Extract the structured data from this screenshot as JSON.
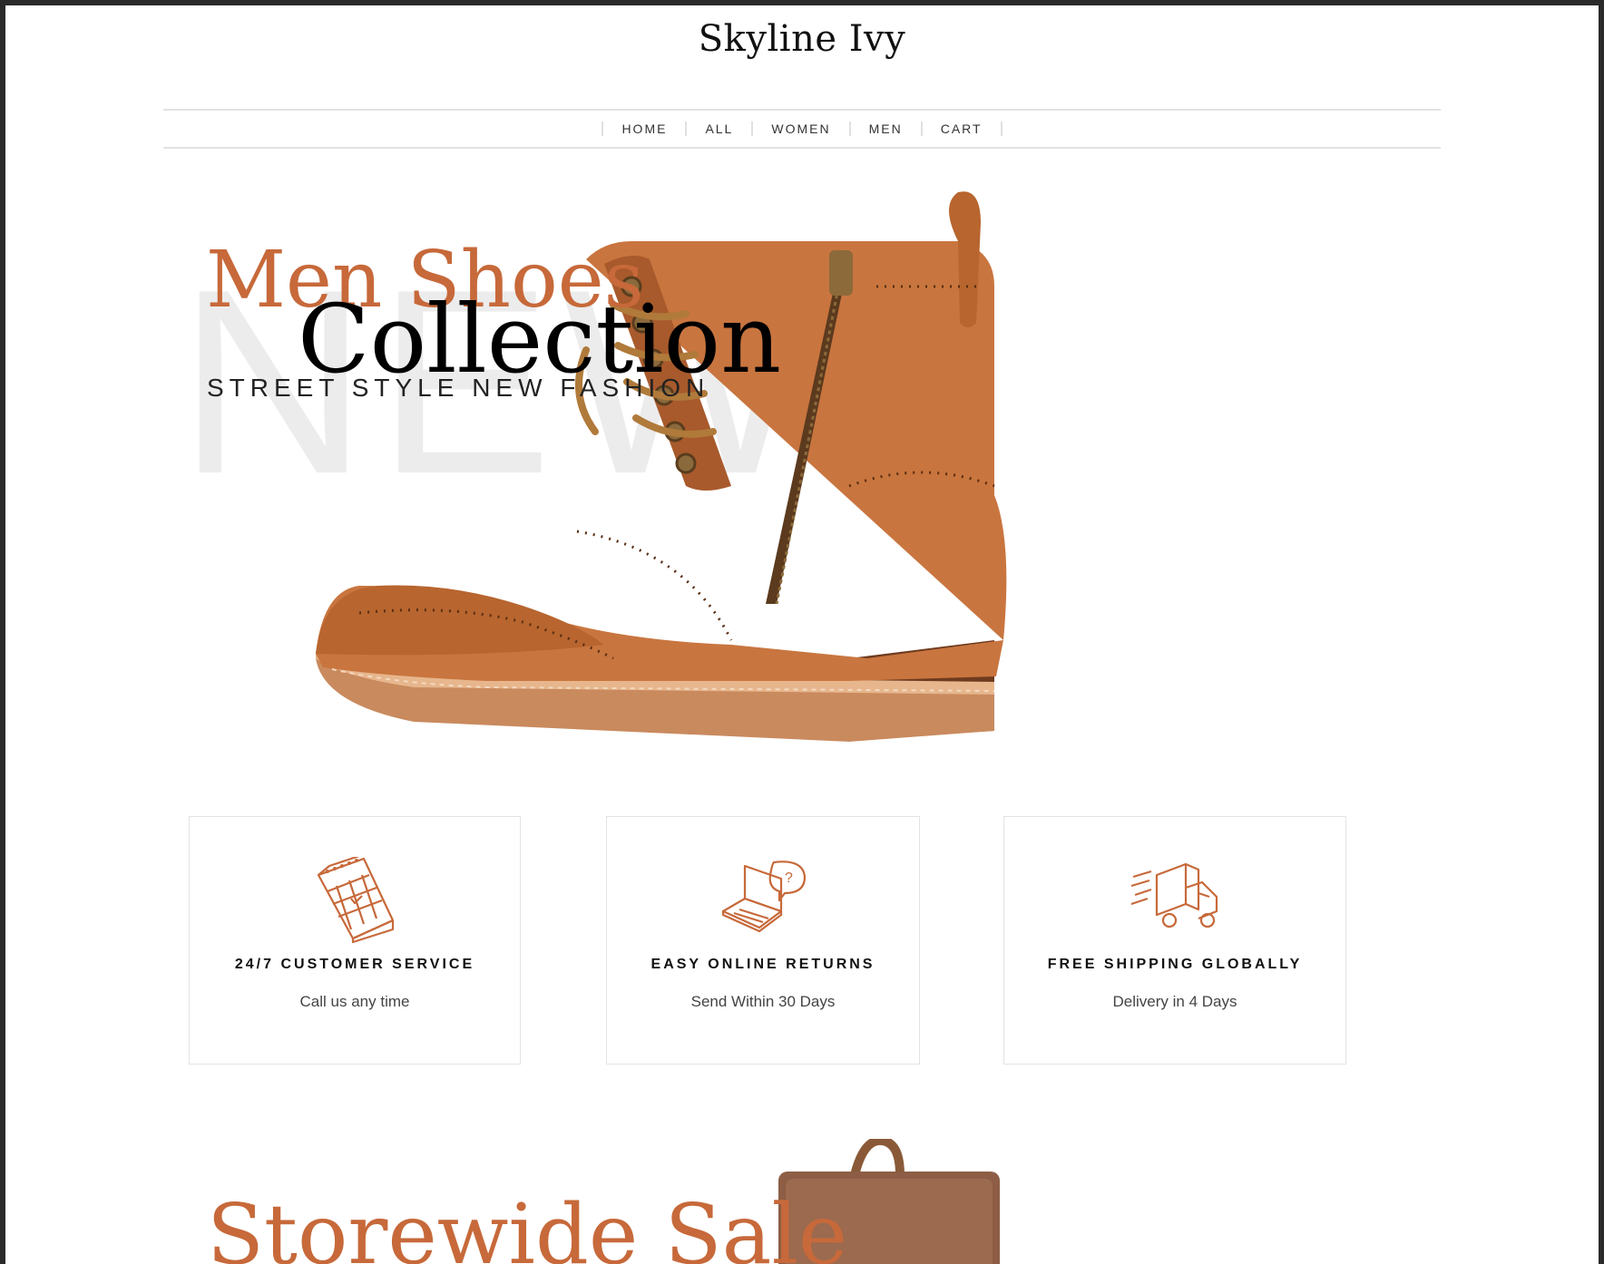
{
  "brand": {
    "name": "Skyline Ivy"
  },
  "nav": {
    "items": [
      "HOME",
      "ALL",
      "WOMEN",
      "MEN",
      "CART"
    ]
  },
  "hero": {
    "ghost_word": "NEW",
    "title": "Men Shoes",
    "subtitle": "STREET STYLE NEW FASHION",
    "collection": "Collection"
  },
  "features": [
    {
      "title": "24/7 CUSTOMER SERVICE",
      "subtitle": "Call us any time",
      "icon": "calendar-icon"
    },
    {
      "title": "EASY ONLINE RETURNS",
      "subtitle": "Send Within 30 Days",
      "icon": "laptop-chat-icon"
    },
    {
      "title": "FREE SHIPPING GLOBALLY",
      "subtitle": "Delivery in 4 Days",
      "icon": "delivery-truck-icon"
    }
  ],
  "sale": {
    "title": "Storewide Sale"
  },
  "colors": {
    "accent": "#c7693a",
    "text": "#111111",
    "ghost": "#ececec",
    "border": "#e3e3e3"
  }
}
